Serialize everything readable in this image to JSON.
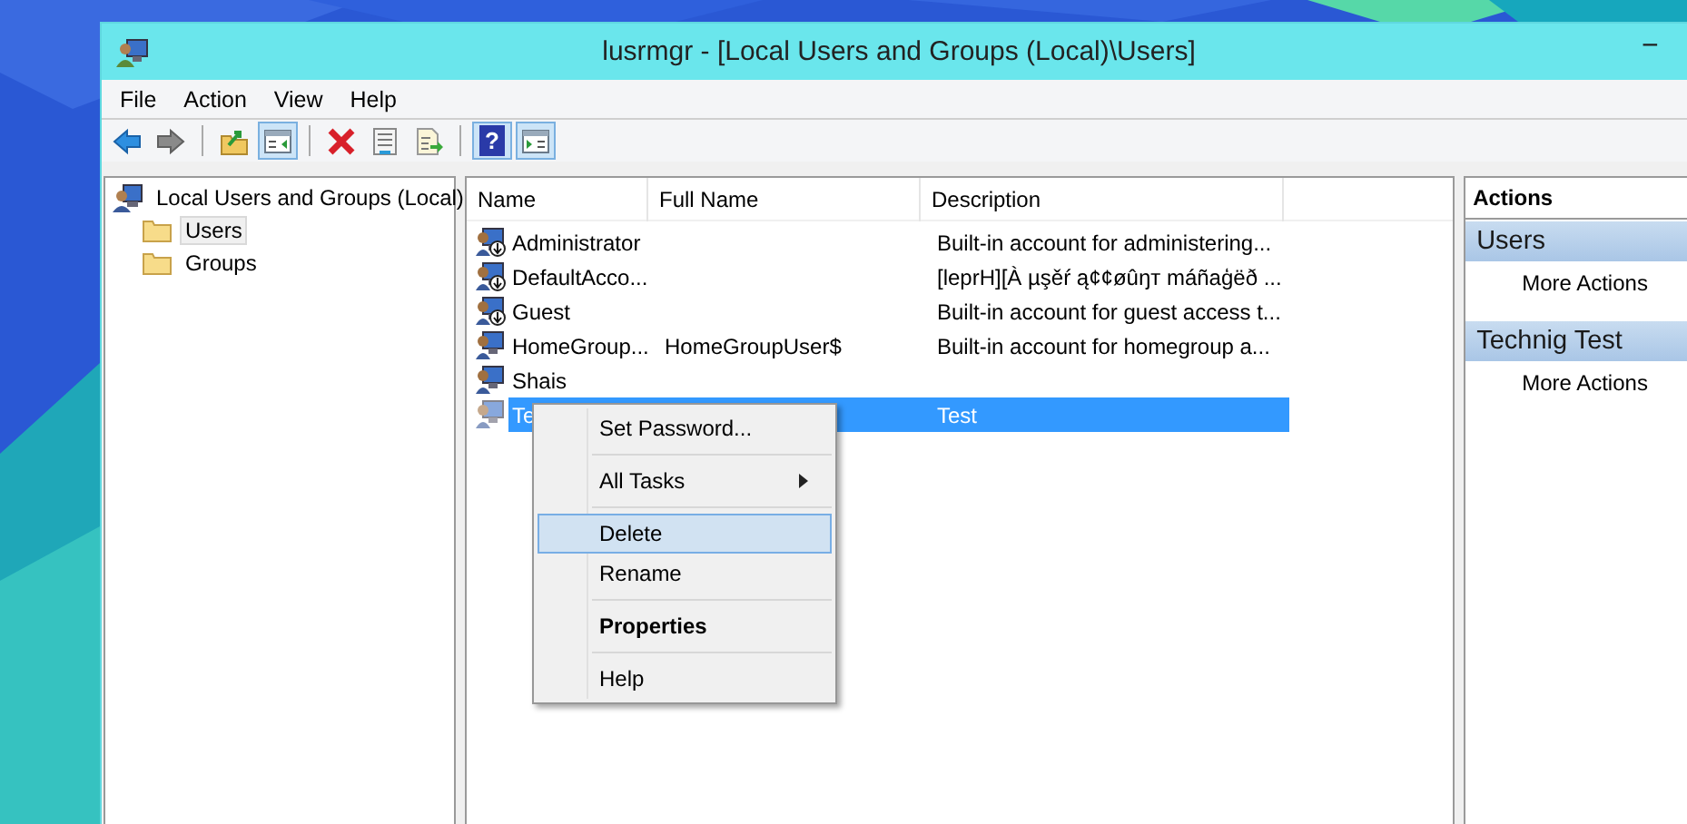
{
  "window": {
    "title": "lusrmgr - [Local Users and Groups (Local)\\Users]",
    "minimize": "−"
  },
  "menu": [
    "File",
    "Action",
    "View",
    "Help"
  ],
  "toolbar": [
    {
      "kind": "back",
      "pressed": false
    },
    {
      "kind": "forward",
      "pressed": false
    },
    {
      "kind": "sep"
    },
    {
      "kind": "up",
      "pressed": false
    },
    {
      "kind": "tree",
      "pressed": true
    },
    {
      "kind": "sep"
    },
    {
      "kind": "delete",
      "pressed": false
    },
    {
      "kind": "properties",
      "pressed": false
    },
    {
      "kind": "export",
      "pressed": false
    },
    {
      "kind": "sep"
    },
    {
      "kind": "help",
      "pressed": true,
      "glyph": "?"
    },
    {
      "kind": "actionpane",
      "pressed": true
    }
  ],
  "tree": [
    {
      "label": "Local Users and Groups (Local)",
      "kind": "computer",
      "selected": false,
      "children": [
        {
          "label": "Users",
          "kind": "folder",
          "selected": true
        },
        {
          "label": "Groups",
          "kind": "folder",
          "selected": false
        }
      ]
    }
  ],
  "table": {
    "columns": [
      "Name",
      "Full Name",
      "Description"
    ],
    "rows": [
      {
        "name": "Administrator",
        "full_name": "",
        "description": "Built-in account for administering...",
        "disabled": true,
        "selected": false
      },
      {
        "name": "DefaultAcco...",
        "full_name": "",
        "description": "[leprH][À µşěŕ ą¢¢øûŋт máñaģëð ...",
        "disabled": true,
        "selected": false
      },
      {
        "name": "Guest",
        "full_name": "",
        "description": "Built-in account for guest access t...",
        "disabled": true,
        "selected": false
      },
      {
        "name": "HomeGroup...",
        "full_name": "HomeGroupUser$",
        "description": "Built-in account for homegroup a...",
        "disabled": false,
        "selected": false
      },
      {
        "name": "Shais",
        "full_name": "",
        "description": "",
        "disabled": false,
        "selected": false
      },
      {
        "name": "Te",
        "full_name": "",
        "description": "Test",
        "disabled": false,
        "selected": true
      }
    ]
  },
  "context_menu": [
    {
      "kind": "item",
      "label": "Set Password...",
      "submenu": false,
      "bold": false,
      "selected": false
    },
    {
      "kind": "separator"
    },
    {
      "kind": "item",
      "label": "All Tasks",
      "submenu": true,
      "bold": false,
      "selected": false
    },
    {
      "kind": "separator"
    },
    {
      "kind": "item",
      "label": "Delete",
      "submenu": false,
      "bold": false,
      "selected": true
    },
    {
      "kind": "item",
      "label": "Rename",
      "submenu": false,
      "bold": false,
      "selected": false
    },
    {
      "kind": "separator"
    },
    {
      "kind": "item",
      "label": "Properties",
      "submenu": false,
      "bold": true,
      "selected": false
    },
    {
      "kind": "separator"
    },
    {
      "kind": "item",
      "label": "Help",
      "submenu": false,
      "bold": false,
      "selected": false
    }
  ],
  "actions": {
    "title": "Actions",
    "sections": [
      {
        "title": "Users",
        "items": [
          "More Actions"
        ]
      },
      {
        "title": "Technig Test",
        "items": [
          "More Actions"
        ]
      }
    ]
  }
}
